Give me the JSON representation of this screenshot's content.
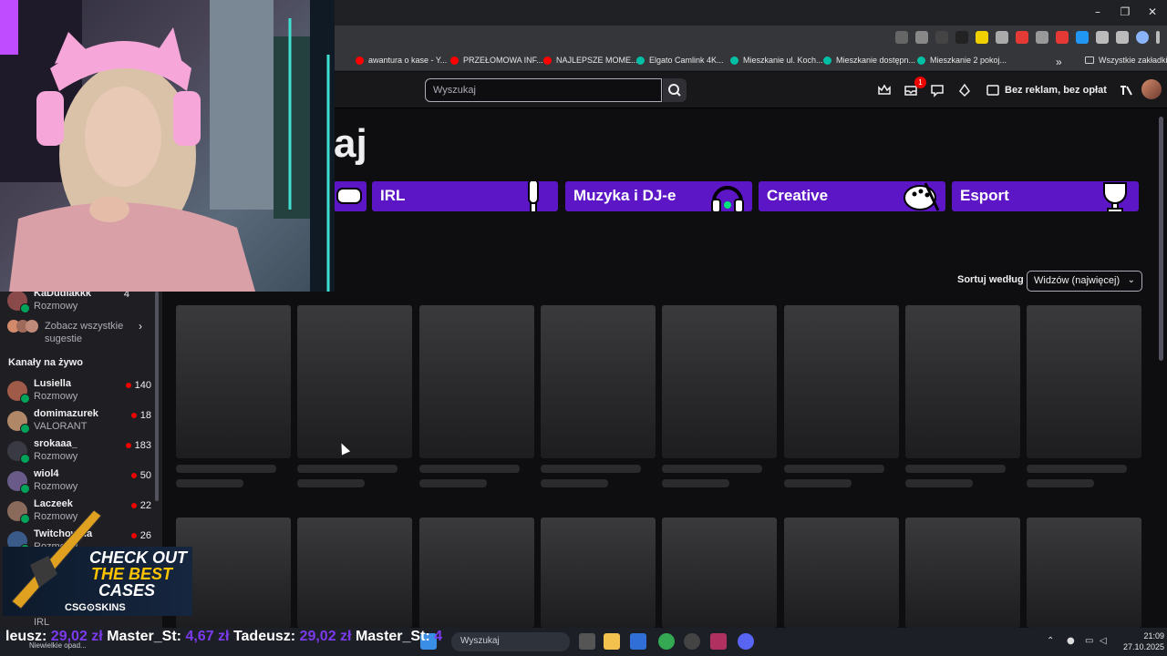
{
  "browser": {
    "bookmarks": [
      {
        "label": "awantura o kase - Y...",
        "color": "#ff0000"
      },
      {
        "label": "PRZEŁOMOWA INF...",
        "color": "#ff0000"
      },
      {
        "label": "NAJLEPSZE MOME...",
        "color": "#ff0000"
      },
      {
        "label": "Elgato Camlink 4K...",
        "color": "#00bfa5"
      },
      {
        "label": "Mieszkanie ul. Koch...",
        "color": "#00bfa5"
      },
      {
        "label": "Mieszkanie dostępn...",
        "color": "#00bfa5"
      },
      {
        "label": "Mieszkanie 2 pokoj...",
        "color": "#00bfa5"
      }
    ],
    "all_bookmarks": "Wszystkie zakładki",
    "more_bookmarks": "»"
  },
  "topnav": {
    "search_placeholder": "Wyszukaj",
    "notification_count": "1",
    "noads_label": "Bez reklam, bez opłat"
  },
  "page": {
    "heading": "aj"
  },
  "categories": [
    {
      "label": "IRL"
    },
    {
      "label": "Muzyka i DJ-e"
    },
    {
      "label": "Creative"
    },
    {
      "label": "Esport"
    }
  ],
  "sort": {
    "label": "Sortuj według",
    "value": "Widzów (najwięcej)"
  },
  "sidebar": {
    "top_partial": {
      "name": "KaDudiakkk",
      "category": "Rozmowy",
      "viewers": "4"
    },
    "see_all": "Zobacz wszystkie sugestie",
    "live_header": "Kanały na żywo",
    "channels": [
      {
        "name": "Lusiella",
        "category": "Rozmowy",
        "viewers": "140",
        "color": "#a05a48"
      },
      {
        "name": "domimazurek",
        "category": "VALORANT",
        "viewers": "18",
        "color": "#b08868"
      },
      {
        "name": "srokaaa_",
        "category": "Rozmowy",
        "viewers": "183",
        "color": "#3a3a44"
      },
      {
        "name": "wiol4",
        "category": "Rozmowy",
        "viewers": "50",
        "color": "#6a5a8a"
      },
      {
        "name": "Laczeek",
        "category": "Rozmowy",
        "viewers": "22",
        "color": "#8a6a5a"
      },
      {
        "name": "Twitchow...a",
        "category": "Rozmowy",
        "viewers": "26",
        "color": "#3a5a8a"
      }
    ],
    "bottom_partial": {
      "category": "IRL"
    }
  },
  "ad": {
    "line1": "CHECK OUT",
    "line2": "THE BEST",
    "line3": "CASES",
    "brand": "CSG⊙SKINS"
  },
  "ticker": [
    {
      "name": "leusz:",
      "amount": "29,02 zł"
    },
    {
      "name": "Master_St:",
      "amount": "4,67 zł"
    },
    {
      "name": "Tadeusz:",
      "amount": "29,02 zł"
    },
    {
      "name": "Master_St:",
      "amount": "4"
    }
  ],
  "taskbar": {
    "search": "Wyszukaj",
    "weather": "Niewielkie opad...",
    "time": "21:09",
    "date": "27.10.2025"
  }
}
